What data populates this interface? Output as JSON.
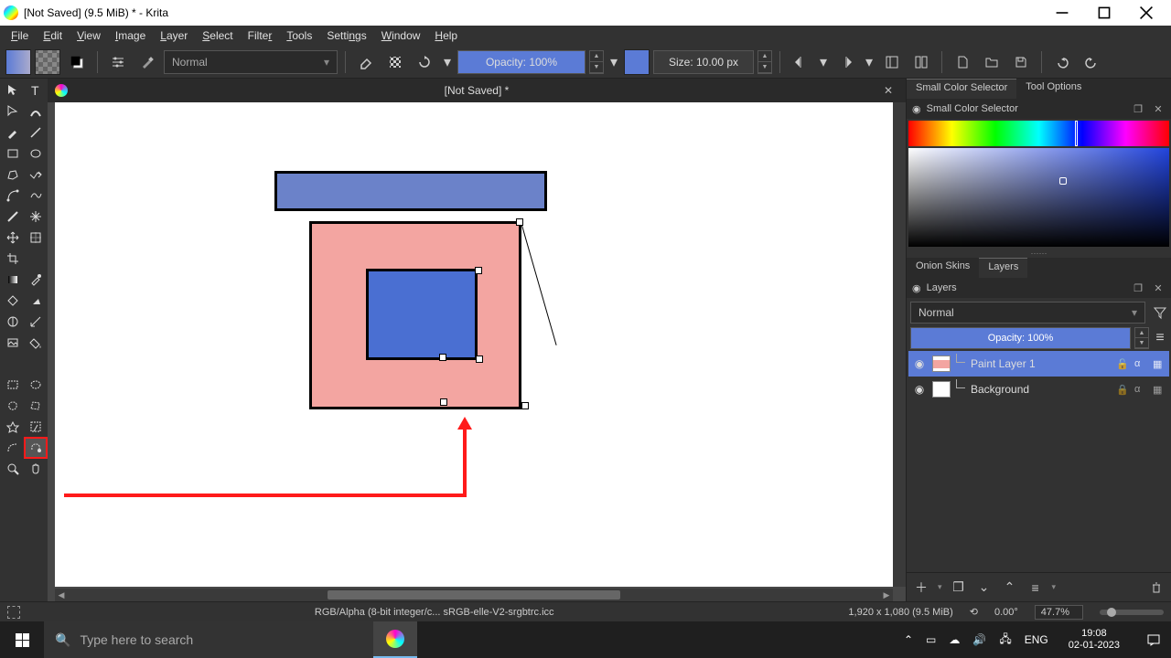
{
  "window": {
    "title": "[Not Saved]  (9.5 MiB)  * - Krita"
  },
  "menu": [
    "File",
    "Edit",
    "View",
    "Image",
    "Layer",
    "Select",
    "Filter",
    "Tools",
    "Settings",
    "Window",
    "Help"
  ],
  "toolbar": {
    "blend_mode": "Normal",
    "opacity": "Opacity: 100%",
    "size": "Size: 10.00 px"
  },
  "doctab": {
    "name": "[Not Saved]  *"
  },
  "rpanel": {
    "tab_color": "Small Color Selector",
    "tab_options": "Tool Options",
    "head_color": "Small Color Selector",
    "tab_onion": "Onion Skins",
    "tab_layers": "Layers",
    "head_layers": "Layers",
    "blend": "Normal",
    "opacity": "Opacity:  100%",
    "layers": [
      {
        "name": "Paint Layer 1",
        "active": true
      },
      {
        "name": "Background",
        "active": false,
        "locked": true
      }
    ]
  },
  "status": {
    "profile": "RGB/Alpha (8-bit integer/c...   sRGB-elle-V2-srgbtrc.icc",
    "dims": "1,920 x 1,080 (9.5 MiB)",
    "angle": "0.00°",
    "zoom": "47.7%"
  },
  "taskbar": {
    "search_placeholder": "Type here to search",
    "lang": "ENG",
    "time": "19:08",
    "date": "02-01-2023"
  }
}
